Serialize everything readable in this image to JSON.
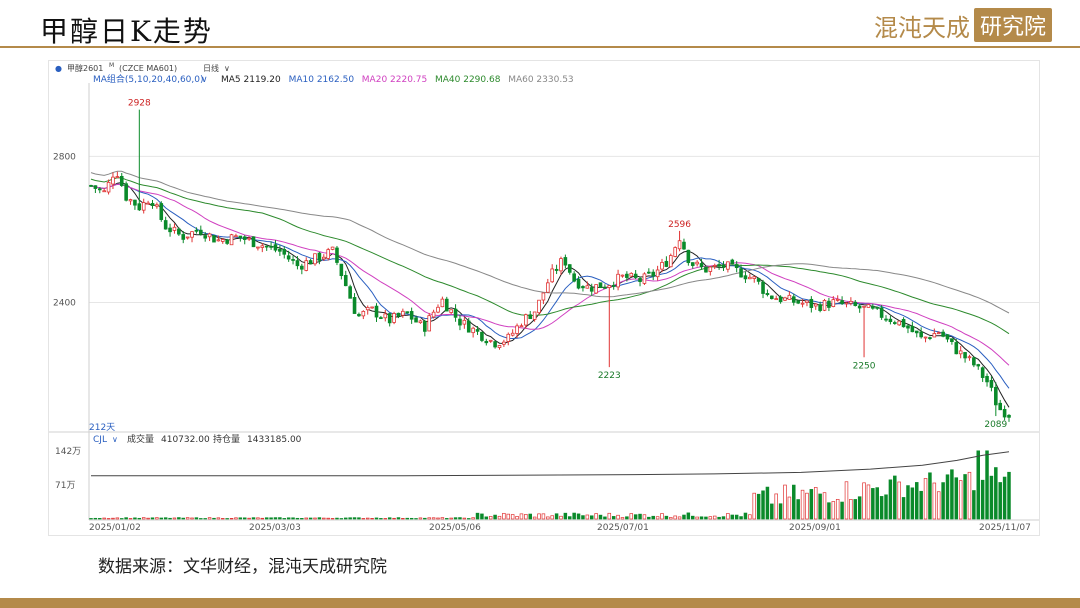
{
  "slide": {
    "title": "甲醇日K走势",
    "brand_text": "混沌天成",
    "brand_box": "研究院",
    "source": "数据来源：文华财经，混沌天成研究院"
  },
  "colors": {
    "accent": "#b48a4a",
    "up": "#e03333",
    "down": "#0a8a2a",
    "ma5": "#222222",
    "ma10": "#2a5fc0",
    "ma20": "#d040c0",
    "ma40": "#2d8a2d",
    "ma60": "#888888"
  },
  "chart_data": {
    "type": "candlestick",
    "instrument": "甲醇2601",
    "instrument_sup": "M",
    "instrument_meta": "(CZCE MA601)",
    "period": "日线",
    "ma_group_label": "MA组合(5,10,20,40,60,0)",
    "ma_values": [
      {
        "name": "MA5",
        "value": "2119.20"
      },
      {
        "name": "MA10",
        "value": "2162.50"
      },
      {
        "name": "MA20",
        "value": "2220.75"
      },
      {
        "name": "MA40",
        "value": "2290.68"
      },
      {
        "name": "MA60",
        "value": "2330.53"
      }
    ],
    "y_ticks": [
      2400,
      2800
    ],
    "ylim": [
      2070,
      2990
    ],
    "x_labels": [
      "2025/01/02",
      "2025/03/03",
      "2025/05/06",
      "2025/07/01",
      "2025/09/01",
      "2025/11/07"
    ],
    "annotations": [
      {
        "text": "2928",
        "value": 2928,
        "kind": "high"
      },
      {
        "text": "2223",
        "value": 2223,
        "kind": "low"
      },
      {
        "text": "2250",
        "value": 2250,
        "kind": "low"
      },
      {
        "text": "2596",
        "value": 2596,
        "kind": "high"
      },
      {
        "text": "2089",
        "value": 2089,
        "kind": "low"
      }
    ],
    "days_label": "212天",
    "trend_points": [
      [
        0,
        2720
      ],
      [
        8,
        2700
      ],
      [
        14,
        2770
      ],
      [
        20,
        2690
      ],
      [
        28,
        2660
      ],
      [
        34,
        2690
      ],
      [
        42,
        2610
      ],
      [
        52,
        2580
      ],
      [
        62,
        2600
      ],
      [
        72,
        2570
      ],
      [
        84,
        2580
      ],
      [
        96,
        2560
      ],
      [
        108,
        2540
      ],
      [
        118,
        2500
      ],
      [
        128,
        2520
      ],
      [
        138,
        2540
      ],
      [
        146,
        2440
      ],
      [
        152,
        2360
      ],
      [
        160,
        2380
      ],
      [
        170,
        2350
      ],
      [
        180,
        2370
      ],
      [
        190,
        2330
      ],
      [
        200,
        2410
      ],
      [
        210,
        2350
      ],
      [
        220,
        2320
      ],
      [
        230,
        2290
      ],
      [
        238,
        2300
      ],
      [
        246,
        2350
      ],
      [
        254,
        2380
      ],
      [
        262,
        2470
      ],
      [
        270,
        2520
      ],
      [
        276,
        2460
      ],
      [
        284,
        2440
      ],
      [
        294,
        2450
      ],
      [
        304,
        2470
      ],
      [
        314,
        2460
      ],
      [
        322,
        2480
      ],
      [
        330,
        2520
      ],
      [
        336,
        2580
      ],
      [
        342,
        2510
      ],
      [
        350,
        2490
      ],
      [
        362,
        2500
      ],
      [
        372,
        2480
      ],
      [
        380,
        2460
      ],
      [
        386,
        2420
      ],
      [
        394,
        2410
      ],
      [
        404,
        2400
      ],
      [
        414,
        2390
      ],
      [
        424,
        2400
      ],
      [
        434,
        2390
      ],
      [
        444,
        2380
      ],
      [
        454,
        2360
      ],
      [
        464,
        2340
      ],
      [
        474,
        2300
      ],
      [
        484,
        2320
      ],
      [
        494,
        2270
      ],
      [
        504,
        2230
      ],
      [
        512,
        2180
      ],
      [
        518,
        2110
      ],
      [
        524,
        2095
      ]
    ],
    "volume_panel": {
      "label": "CJL",
      "volume_label": "成交量",
      "volume_value": "410732.00",
      "oi_label": "持仓量",
      "oi_value": "1433185.00",
      "y_ticks": [
        "142万",
        "71万"
      ],
      "oi_points": [
        [
          0,
          90
        ],
        [
          60,
          90
        ],
        [
          120,
          90
        ],
        [
          180,
          90
        ],
        [
          240,
          91
        ],
        [
          300,
          92
        ],
        [
          360,
          94
        ],
        [
          410,
          97
        ],
        [
          450,
          104
        ],
        [
          480,
          112
        ],
        [
          500,
          122
        ],
        [
          515,
          133
        ],
        [
          530,
          140
        ]
      ]
    }
  }
}
